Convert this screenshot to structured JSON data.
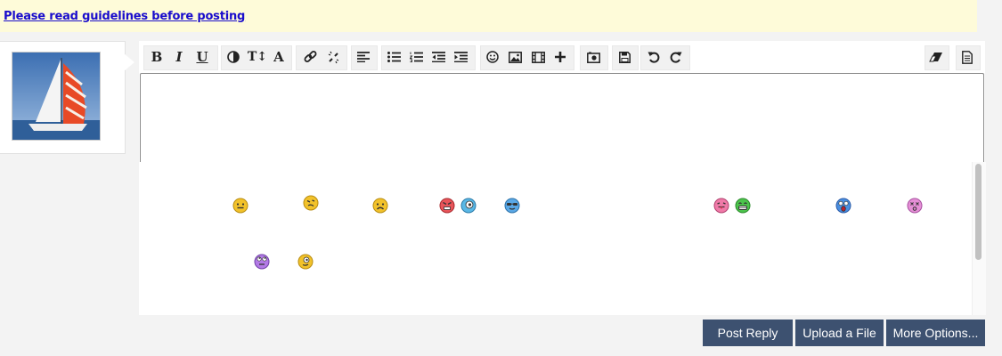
{
  "notice": {
    "guidelines_link": "Please read guidelines before posting"
  },
  "toolbar": {
    "buttons": [
      {
        "name": "bold-button",
        "glyph": "B"
      },
      {
        "name": "italic-button",
        "glyph": "I"
      },
      {
        "name": "underline-button",
        "glyph": "U"
      },
      {
        "name": "text-color-button",
        "icon": "contrast-icon"
      },
      {
        "name": "font-size-button",
        "glyph": "T↕"
      },
      {
        "name": "font-family-button",
        "glyph": "A"
      },
      {
        "name": "insert-link-button",
        "icon": "link-icon"
      },
      {
        "name": "remove-link-button",
        "icon": "unlink-icon"
      },
      {
        "name": "align-button",
        "icon": "align-left-icon"
      },
      {
        "name": "bullet-list-button",
        "icon": "bullet-list-icon"
      },
      {
        "name": "numbered-list-button",
        "icon": "numbered-list-icon"
      },
      {
        "name": "outdent-button",
        "icon": "outdent-icon"
      },
      {
        "name": "indent-button",
        "icon": "indent-icon"
      },
      {
        "name": "smilies-button",
        "icon": "smiley-icon"
      },
      {
        "name": "insert-image-button",
        "icon": "image-icon"
      },
      {
        "name": "insert-media-button",
        "icon": "film-icon"
      },
      {
        "name": "insert-more-button",
        "icon": "plus-icon"
      },
      {
        "name": "screenshot-button",
        "icon": "camera-icon"
      },
      {
        "name": "save-draft-button",
        "icon": "floppy-icon"
      },
      {
        "name": "undo-button",
        "icon": "undo-icon"
      },
      {
        "name": "redo-button",
        "icon": "redo-icon"
      },
      {
        "name": "remove-formatting-button",
        "icon": "eraser-icon"
      },
      {
        "name": "view-source-button",
        "icon": "document-icon"
      }
    ]
  },
  "smilies": [
    {
      "name": "smiley-embarrassed",
      "color": "#f2c22a"
    },
    {
      "name": "smiley-confused",
      "color": "#f2c22a"
    },
    {
      "name": "smiley-frown",
      "color": "#f2c22a"
    },
    {
      "name": "smiley-mad",
      "color": "#e8555a"
    },
    {
      "name": "smiley-shocked",
      "color": "#5ab8e6"
    },
    {
      "name": "smiley-cool",
      "color": "#5aa8e6"
    },
    {
      "name": "smiley-tongue",
      "color": "#f07aa8"
    },
    {
      "name": "smiley-grin",
      "color": "#4cc44c"
    },
    {
      "name": "smiley-eek",
      "color": "#4a8fe0"
    },
    {
      "name": "smiley-dizzy",
      "color": "#e58fd6"
    },
    {
      "name": "smiley-rolleyes",
      "color": "#b37ae6"
    },
    {
      "name": "smiley-wink",
      "color": "#f2c22a"
    }
  ],
  "actions": {
    "post_reply": "Post Reply",
    "upload_file": "Upload a File",
    "more_options": "More Options..."
  },
  "colors": {
    "button_bg": "#3d5170",
    "notice_bg": "#fefbd9",
    "link": "#1a0dcc"
  }
}
